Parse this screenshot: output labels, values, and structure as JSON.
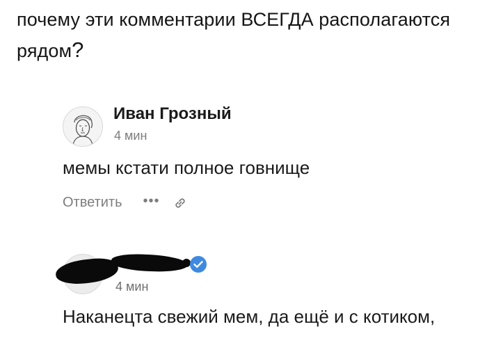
{
  "headline": {
    "text": "почему эти комментарии ВСЕГДА располагаются рядом",
    "question_mark": "?"
  },
  "comments": [
    {
      "author": "Иван Грозный",
      "time": "4 мин",
      "text": "мемы кстати полное говнище",
      "actions": {
        "reply_label": "Ответить",
        "more_icon": "more-dots-icon",
        "link_icon": "link-icon"
      }
    },
    {
      "author_redacted": true,
      "verified": true,
      "time": "4 мин",
      "text": "Наканецта свежий мем, да ещё и с котиком,"
    }
  ],
  "colors": {
    "verified": "#3f8ae0",
    "muted_text": "#7d7d7d"
  }
}
